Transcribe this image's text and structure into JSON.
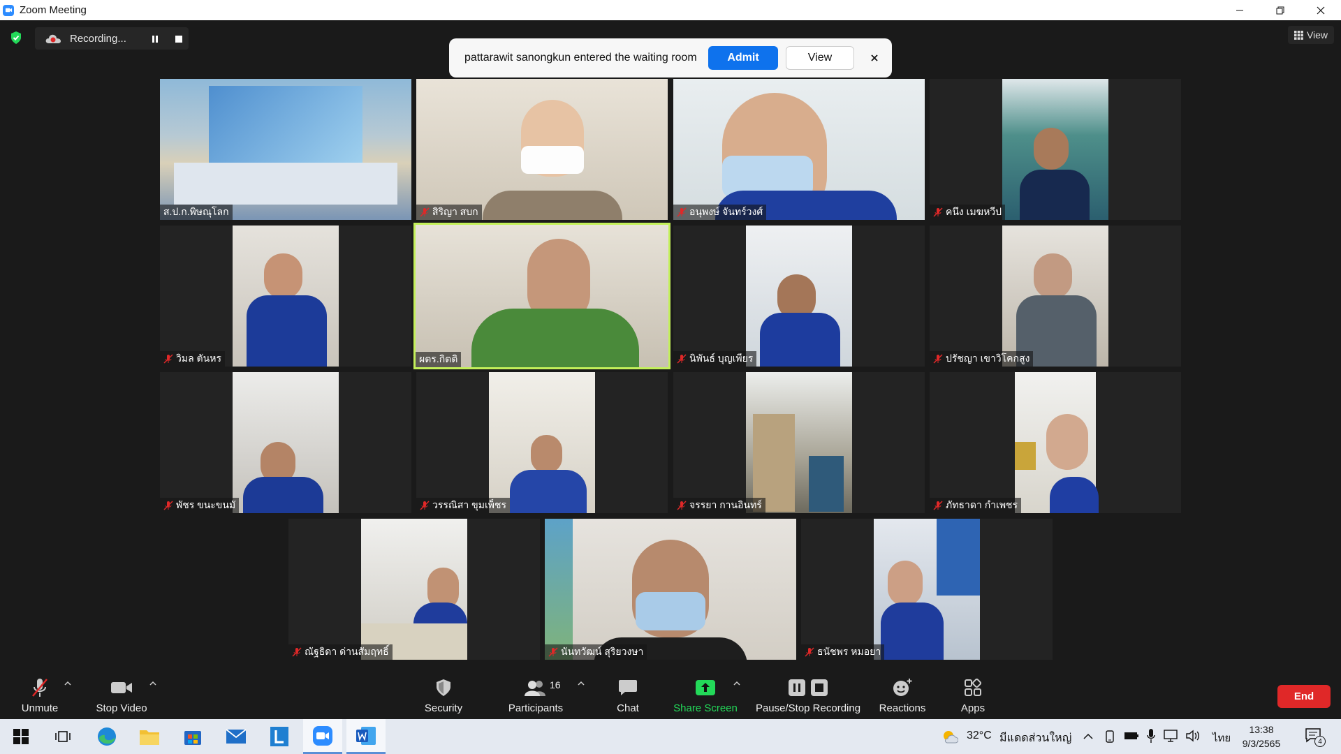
{
  "window": {
    "title": "Zoom Meeting"
  },
  "top": {
    "recording_label": "Recording...",
    "view_label": "View"
  },
  "notification": {
    "text": "pattarawit sanongkun entered the waiting room",
    "admit_label": "Admit",
    "view_label": "View"
  },
  "participants": [
    {
      "name": "ส.ป.ก.พิษณุโลก",
      "muted": false
    },
    {
      "name": "สิริญา สบก",
      "muted": true
    },
    {
      "name": "อนุพงษ์ จันทร์วงศ์",
      "muted": true
    },
    {
      "name": "คนึง เมฆหวีป",
      "muted": true
    },
    {
      "name": "วิมล ตันหร",
      "muted": true
    },
    {
      "name": "ผตร.กิตติ",
      "muted": false,
      "active_speaker": true
    },
    {
      "name": "นิพันธ์ บุญเพียร",
      "muted": true
    },
    {
      "name": "ปรัชญา เขาวิโคกสูง",
      "muted": true
    },
    {
      "name": "พัชร ขนะขนมั",
      "muted": true
    },
    {
      "name": "วรรณิสา ขุมเพ็ชร",
      "muted": true
    },
    {
      "name": "จรรยา กานอินทร์",
      "muted": true
    },
    {
      "name": "ภัทธาดา กำเพชร",
      "muted": true
    },
    {
      "name": "ณัฐธิดา ด่านสัมฤทธิ์",
      "muted": true
    },
    {
      "name": "นันทวัฒน์ สุริยวงษา",
      "muted": true
    },
    {
      "name": "ธนัชพร หมอยา",
      "muted": true
    }
  ],
  "toolbar": {
    "unmute": "Unmute",
    "stop_video": "Stop Video",
    "security": "Security",
    "participants": "Participants",
    "participants_count": "16",
    "chat": "Chat",
    "share_screen": "Share Screen",
    "pause_recording": "Pause/Stop Recording",
    "reactions": "Reactions",
    "apps": "Apps",
    "end": "End"
  },
  "taskbar": {
    "temperature": "32°C",
    "weather": "มีแดดส่วนใหญ่",
    "language": "ไทย",
    "time": "13:38",
    "date": "9/3/2565",
    "notification_count": "4"
  },
  "colors": {
    "zoom_blue": "#0e72ed",
    "share_green": "#23d959",
    "end_red": "#e02828",
    "active_speaker": "#c3f05a",
    "mute_red": "#e02828"
  }
}
